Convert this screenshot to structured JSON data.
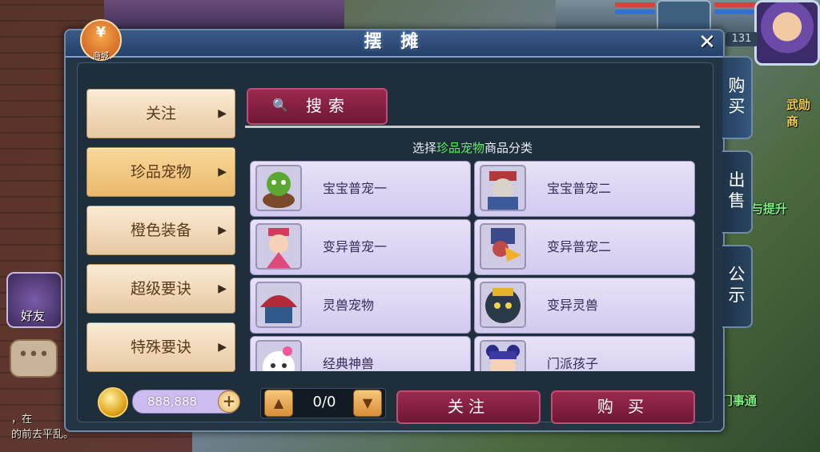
{
  "dialog": {
    "title": "摆 摊",
    "close_label": "✕"
  },
  "shop": {
    "label": "商城"
  },
  "categories": [
    {
      "label": "关注",
      "active": false
    },
    {
      "label": "珍品宠物",
      "active": true
    },
    {
      "label": "橙色装备",
      "active": false
    },
    {
      "label": "超级要诀",
      "active": false
    },
    {
      "label": "特殊要诀",
      "active": false
    }
  ],
  "search": {
    "label": "搜索"
  },
  "hint": {
    "prefix": "选择",
    "highlight": "珍品宠物",
    "suffix": "商品分类"
  },
  "pets": [
    {
      "name": "宝宝普宠一",
      "icon": "green-turtle-pet-icon"
    },
    {
      "name": "宝宝普宠二",
      "icon": "armored-warrior-pet-icon"
    },
    {
      "name": "变异普宠一",
      "icon": "princess-pet-icon"
    },
    {
      "name": "变异普宠二",
      "icon": "masked-bird-pet-icon"
    },
    {
      "name": "灵兽宠物",
      "icon": "fan-beast-pet-icon"
    },
    {
      "name": "变异灵兽",
      "icon": "demon-mask-pet-icon"
    },
    {
      "name": "经典神兽",
      "icon": "white-spirit-pet-icon"
    },
    {
      "name": "门派孩子",
      "icon": "sect-child-pet-icon"
    }
  ],
  "wallet": {
    "amount": "888,888"
  },
  "pager": {
    "text": "0/0"
  },
  "actions": {
    "follow": "关注",
    "buy": "购 买"
  },
  "side_tabs": [
    {
      "label_lines": [
        "购",
        "买"
      ],
      "active": true
    },
    {
      "label_lines": [
        "出",
        "售"
      ],
      "active": false
    },
    {
      "label_lines": [
        "公",
        "示"
      ],
      "active": false
    }
  ],
  "background": {
    "level": "131",
    "right_texts": [
      "武勋商",
      "与提升",
      "门事通"
    ],
    "friend_label": "好友",
    "chat_lines": [
      "，在",
      "的前去平乱。"
    ]
  }
}
